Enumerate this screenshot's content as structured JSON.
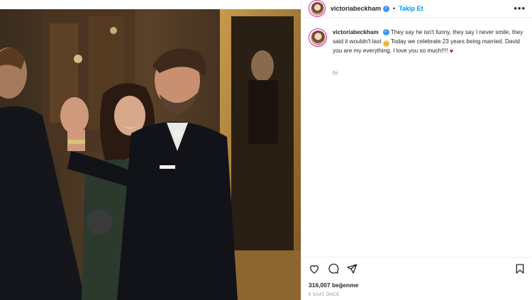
{
  "post": {
    "username": "victoriabeckham",
    "verified_icon": "verified-badge-icon",
    "follow_label": "Takip Et",
    "separator": "•",
    "more_label": "•••",
    "caption_text": "They say he isn't funny, they say I never smile, they said it wouldn't last",
    "caption_text_2": "Today we celebrate 23 years being married. David you are my everything, I love you so much!!!!",
    "emoji_1": "😂",
    "emoji_2": "♥",
    "caption_age": "6s",
    "likes": "316,007 beğenme",
    "date": "6 SAAT ÖNCE"
  },
  "icons": {
    "like": "heart-icon",
    "comment": "comment-icon",
    "share": "paper-plane-icon",
    "save": "bookmark-icon"
  },
  "colors": {
    "follow": "#0095f6",
    "verified": "#3897f0",
    "avatar_ring": "#d6249f"
  }
}
